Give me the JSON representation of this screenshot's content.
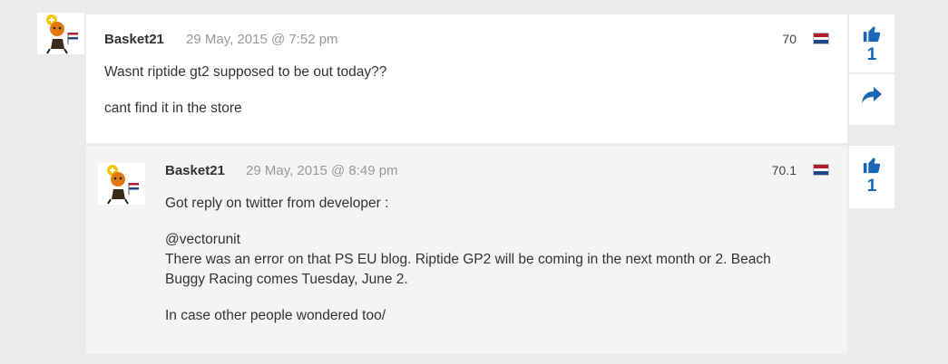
{
  "comments": [
    {
      "author": "Basket21",
      "date": "29 May, 2015 @ 7:52 pm",
      "level": "70",
      "likes": "1",
      "body": [
        "Wasnt riptide gt2 supposed to be out today??",
        "cant find it in the store"
      ]
    },
    {
      "author": "Basket21",
      "date": "29 May, 2015 @ 8:49 pm",
      "level": "70.1",
      "likes": "1",
      "body": [
        "Got reply on twitter from developer :",
        "@vectorunit",
        "There was an error on that PS EU blog. Riptide GP2 will be coming in the next month or 2. Beach",
        "Buggy Racing comes Tuesday, June 2.",
        "In case other people wondered too/"
      ]
    }
  ],
  "icons": {
    "like": "thumbs-up-icon",
    "share": "share-arrow-icon",
    "flag": "netherlands-flag-icon"
  },
  "colors": {
    "accent": "#1a66b5",
    "flag_red": "#ae1c28",
    "flag_white": "#ffffff",
    "flag_blue": "#21468b"
  }
}
